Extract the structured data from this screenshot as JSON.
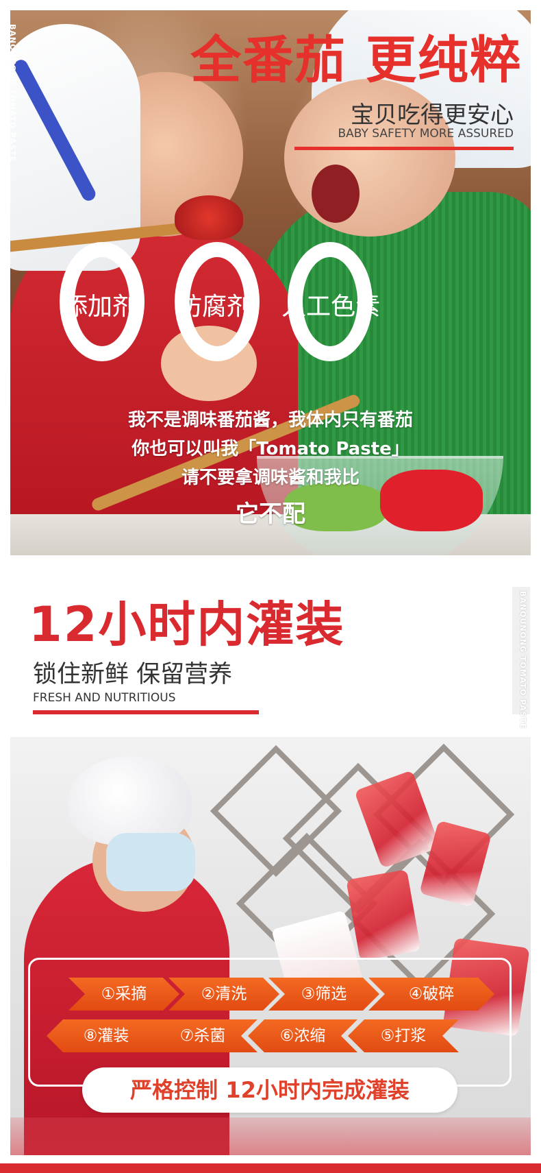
{
  "hero": {
    "title": "全番茄 更纯粹",
    "subtitle": "宝贝吃得更安心",
    "subtitle_en": "BABY SAFETY MORE ASSURED",
    "side_brand": "BANQUNONG TOMATO PASTE",
    "zero_labels": [
      "添加剂",
      "防腐剂",
      "人工色素"
    ],
    "slogan_lines": [
      "我不是调味番茄酱，我体内只有番茄",
      "你也可以叫我「Tomato Paste」",
      "请不要拿调味酱和我比",
      "它不配"
    ]
  },
  "section2": {
    "title": "12小时内灌装",
    "subtitle": "锁住新鲜 保留营养",
    "subtitle_en": "FRESH AND NUTRITIOUS",
    "side_brand": "BANQUNONG TOMATO PASTE"
  },
  "process": {
    "steps_top": [
      "①采摘",
      "②清洗",
      "③筛选",
      "④破碎"
    ],
    "steps_bottom": [
      "⑧灌装",
      "⑦杀菌",
      "⑥浓缩",
      "⑤打浆"
    ],
    "banner": "严格控制 12小时内完成灌装"
  },
  "colors": {
    "brand_red": "#d92b2f",
    "step_orange": "#f0561a",
    "banner_text": "#e0412b"
  }
}
